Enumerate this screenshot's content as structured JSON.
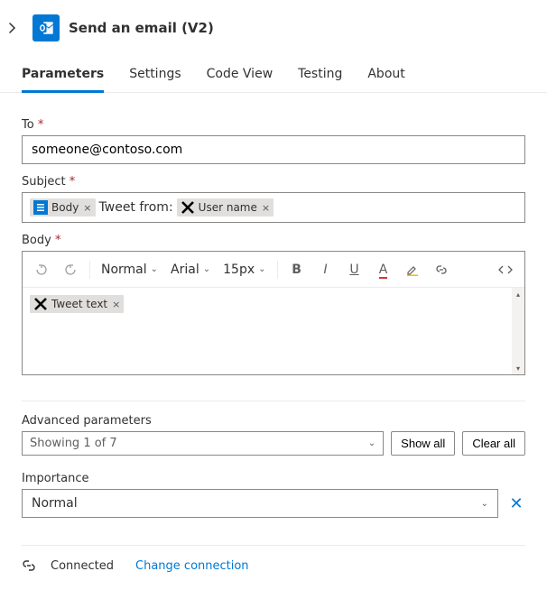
{
  "header": {
    "title": "Send an email (V2)"
  },
  "tabs": {
    "items": [
      "Parameters",
      "Settings",
      "Code View",
      "Testing",
      "About"
    ],
    "active": 0
  },
  "fields": {
    "to": {
      "label": "To",
      "value": "someone@contoso.com"
    },
    "subject": {
      "label": "Subject",
      "prefix_token": "Body",
      "static_text": "Tweet from:",
      "user_token": "User name"
    },
    "body": {
      "label": "Body",
      "token": "Tweet text"
    }
  },
  "rte": {
    "font_style": "Normal",
    "font_family": "Arial",
    "font_size": "15px"
  },
  "advanced": {
    "label": "Advanced parameters",
    "showing": "Showing 1 of 7",
    "show_all": "Show all",
    "clear_all": "Clear all"
  },
  "importance": {
    "label": "Importance",
    "value": "Normal"
  },
  "footer": {
    "status": "Connected",
    "change": "Change connection"
  }
}
